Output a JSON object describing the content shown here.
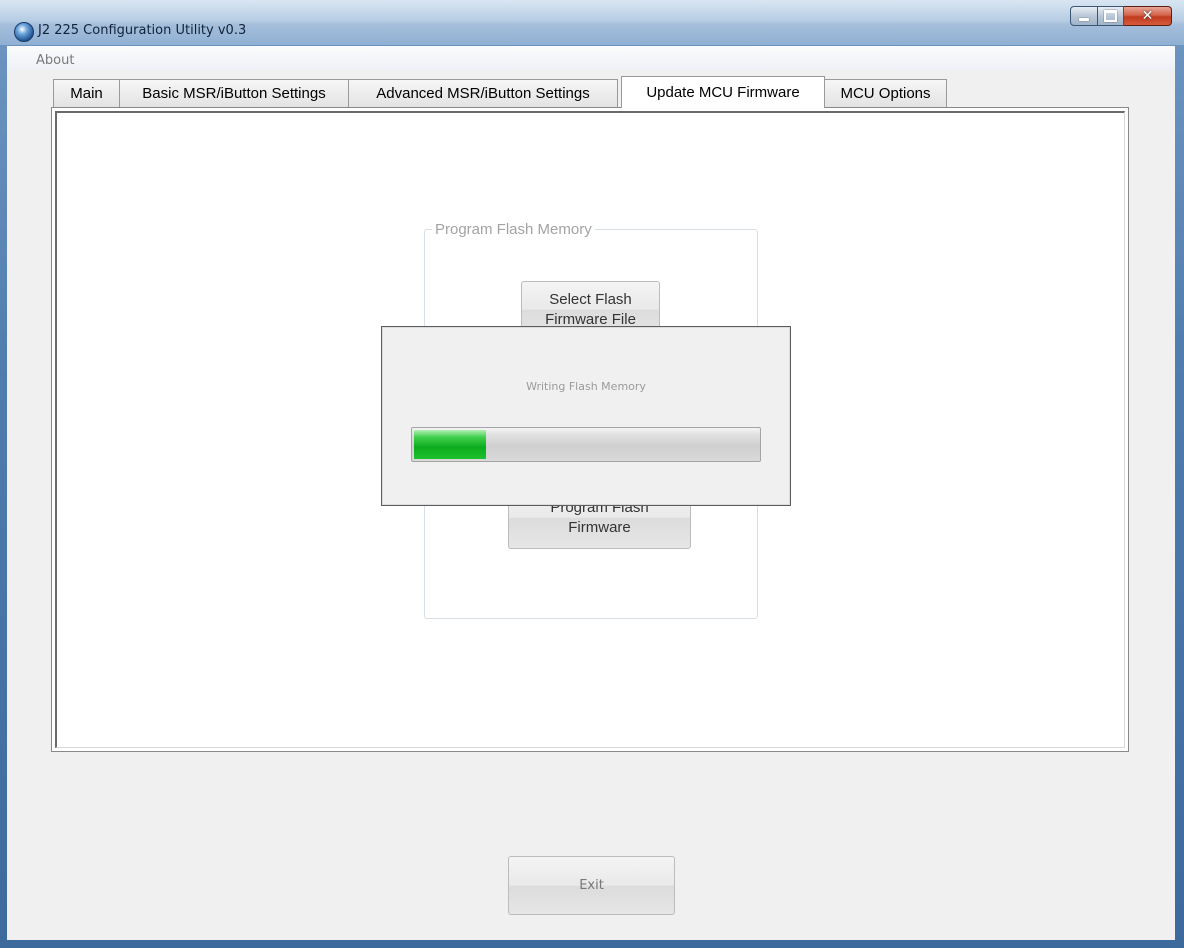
{
  "window": {
    "title": "J2 225 Configuration Utility  v0.3",
    "caption_buttons": [
      "minimize",
      "maximize",
      "close"
    ]
  },
  "menu": {
    "items": [
      {
        "label": "About"
      }
    ]
  },
  "tabs": [
    {
      "label": "Main",
      "active": false
    },
    {
      "label": "Basic MSR/iButton Settings",
      "active": false
    },
    {
      "label": "Advanced MSR/iButton Settings",
      "active": false
    },
    {
      "label": "Update MCU Firmware",
      "active": true
    },
    {
      "label": "MCU Options",
      "active": false
    }
  ],
  "program_flash": {
    "group_label": "Program Flash Memory",
    "select_button": {
      "line1": "Select Flash",
      "line2": "Firmware File"
    },
    "program_button": {
      "line1": "Program Flash",
      "line2": "Firmware"
    }
  },
  "progress_dialog": {
    "label": "Writing Flash Memory",
    "progress_fraction": 0.21,
    "bar_color": "#0cab1f"
  },
  "footer": {
    "exit_label": "Exit"
  },
  "colors": {
    "title_gradient_top": "#d9e6f2",
    "close_button": "#c23a1f",
    "client_bg": "#f0f0f0"
  }
}
